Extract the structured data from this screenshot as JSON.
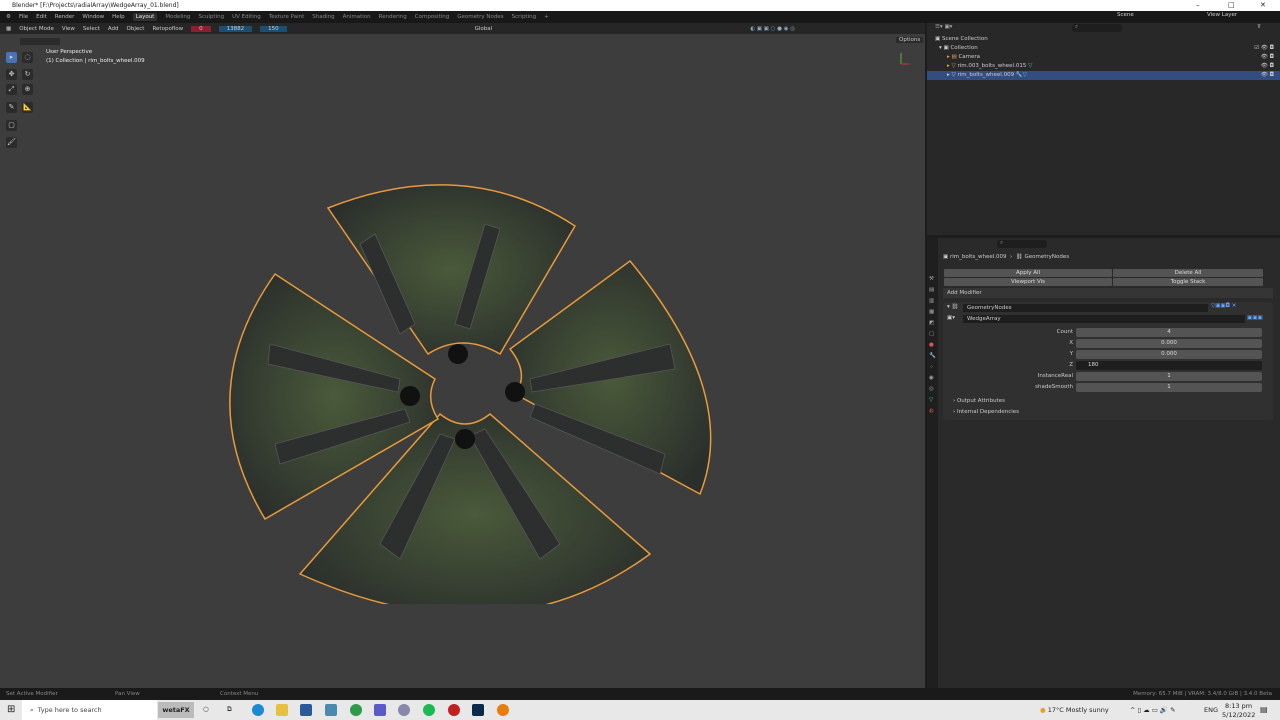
{
  "title": "Blender* [F:\\Projects\\radialArray\\WedgeArray_01.blend]",
  "menu": [
    "File",
    "Edit",
    "Render",
    "Window",
    "Help"
  ],
  "workspaces": [
    "Layout",
    "Modeling",
    "Sculpting",
    "UV Editing",
    "Texture Paint",
    "Shading",
    "Animation",
    "Rendering",
    "Compositing",
    "Geometry Nodes",
    "Scripting",
    "+"
  ],
  "header": {
    "mode": "Object Mode",
    "items": [
      "View",
      "Select",
      "Add",
      "Object"
    ],
    "retopo": "Retopoflow",
    "v1": "0",
    "v2": "13882",
    "v3": "150",
    "orientation": "Global",
    "options": "Options"
  },
  "viewport": {
    "perspective": "User Perspective",
    "collection": "(1) Collection | rim_bolts_wheel.009"
  },
  "outliner": {
    "scene": "Scene",
    "view_layer": "View Layer",
    "rows": [
      "Scene Collection",
      "Collection",
      "Camera",
      "rim.003_bolts_wheel.015",
      "rim_bolts_wheel.009"
    ]
  },
  "props": {
    "object": "rim_bolts_wheel.009",
    "modifier_crumb": "GeometryNodes",
    "apply_all": "Apply All",
    "delete_all": "Delete All",
    "viewport_vis": "Viewport Vis",
    "toggle_stack": "Toggle Stack",
    "add_modifier": "Add Modifier",
    "modifier_name": "GeometryNodes",
    "node_group": "WedgeArray",
    "fields": [
      {
        "label": "Count",
        "value": "4"
      },
      {
        "label": "X",
        "value": "0.000"
      },
      {
        "label": "Y",
        "value": "0.000"
      },
      {
        "label": "Z",
        "value": "180"
      },
      {
        "label": "InstanceReal",
        "value": "1"
      },
      {
        "label": "shadeSmooth",
        "value": "1"
      }
    ],
    "output_attributes": "Output Attributes",
    "internal_deps": "Internal Dependencies"
  },
  "status": {
    "left": "Set Active Modifier",
    "mid": "Pan View",
    "ctx": "Context Menu",
    "right": "Memory: 65.7 MiB | VRAM: 3.4/8.0 GiB | 3.4.0 Beta"
  },
  "taskbar": {
    "search": "Type here to search",
    "weather": "17°C  Mostly sunny",
    "lang": "ENG",
    "time": "8:13 pm",
    "date": "5/12/2022",
    "app": "wetaFX"
  }
}
